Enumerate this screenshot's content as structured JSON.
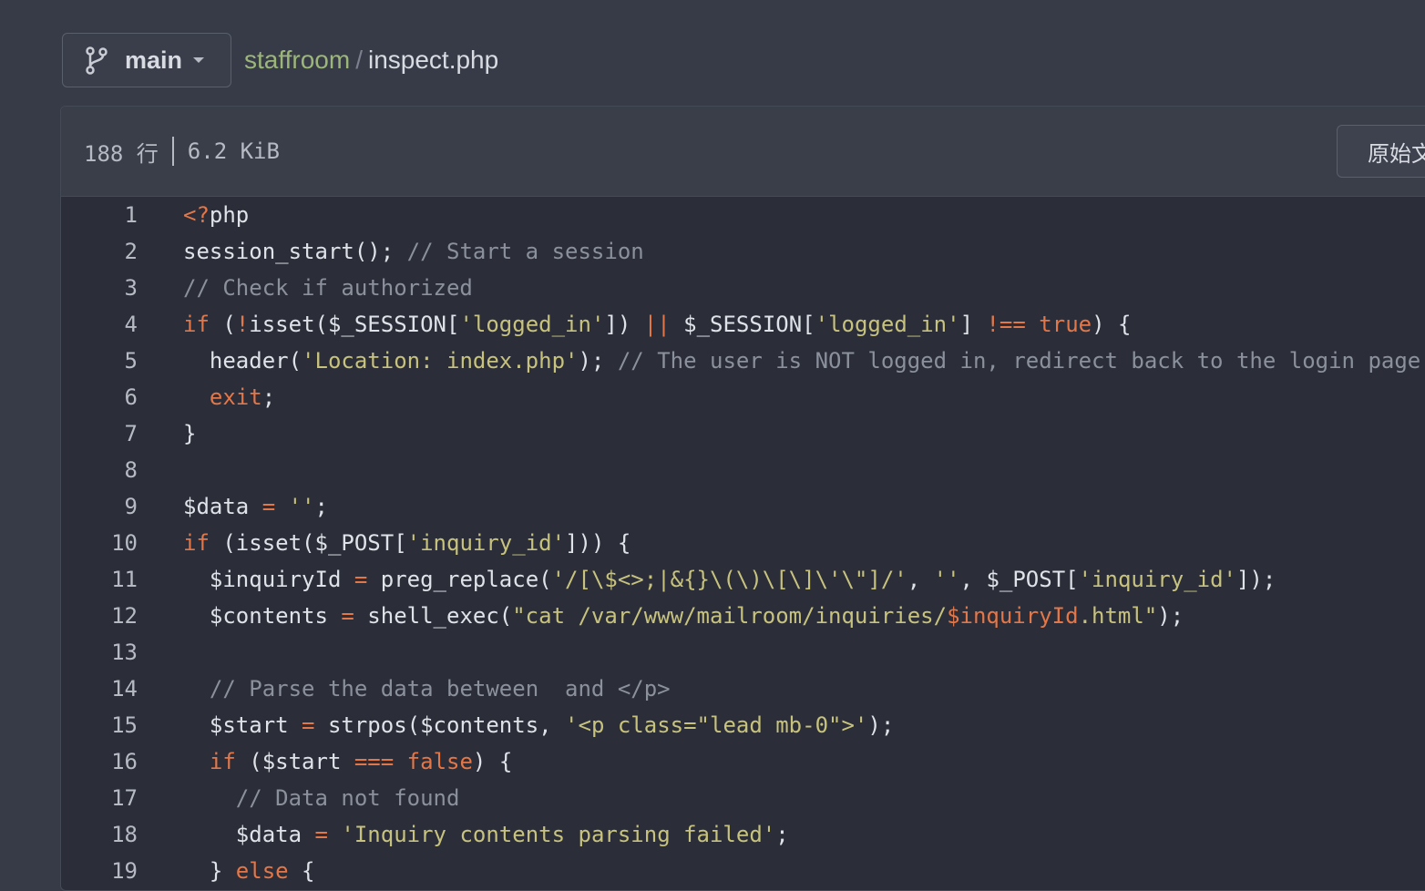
{
  "branch": {
    "label": "main",
    "icon": "git-branch-icon"
  },
  "breadcrumb": {
    "repo": "staffroom",
    "separator": "/",
    "file": "inspect.php"
  },
  "file_info": {
    "lines": "188 行",
    "size": "6.2 KiB",
    "raw_button": "原始文件"
  },
  "colors": {
    "keyword": "#e2774a",
    "string": "#c7c27e",
    "comment": "#8b909d",
    "plain": "#dfe2e8",
    "repo_link": "#9cb67a"
  },
  "code_lines": [
    {
      "n": "1",
      "tokens": [
        [
          "kw",
          "<?"
        ],
        [
          "pl",
          "php"
        ]
      ]
    },
    {
      "n": "2",
      "tokens": [
        [
          "pl",
          "session_start(); "
        ],
        [
          "cm",
          "// Start a session"
        ]
      ]
    },
    {
      "n": "3",
      "tokens": [
        [
          "cm",
          "// Check if authorized"
        ]
      ]
    },
    {
      "n": "4",
      "tokens": [
        [
          "kw",
          "if"
        ],
        [
          "pl",
          " ("
        ],
        [
          "op",
          "!"
        ],
        [
          "pl",
          "isset($_SESSION["
        ],
        [
          "str",
          "'logged_in'"
        ],
        [
          "pl",
          "]) "
        ],
        [
          "op",
          "||"
        ],
        [
          "pl",
          " $_SESSION["
        ],
        [
          "str",
          "'logged_in'"
        ],
        [
          "pl",
          "] "
        ],
        [
          "op",
          "!=="
        ],
        [
          "pl",
          " "
        ],
        [
          "kw",
          "true"
        ],
        [
          "pl",
          ") {"
        ]
      ]
    },
    {
      "n": "5",
      "tokens": [
        [
          "pl",
          "  header("
        ],
        [
          "str",
          "'Location: index.php'"
        ],
        [
          "pl",
          "); "
        ],
        [
          "cm",
          "// The user is NOT logged in, redirect back to the login page"
        ]
      ]
    },
    {
      "n": "6",
      "tokens": [
        [
          "pl",
          "  "
        ],
        [
          "kw",
          "exit"
        ],
        [
          "pl",
          ";"
        ]
      ]
    },
    {
      "n": "7",
      "tokens": [
        [
          "pl",
          "}"
        ]
      ]
    },
    {
      "n": "8",
      "tokens": []
    },
    {
      "n": "9",
      "tokens": [
        [
          "pl",
          "$data "
        ],
        [
          "op",
          "="
        ],
        [
          "pl",
          " "
        ],
        [
          "str",
          "''"
        ],
        [
          "pl",
          ";"
        ]
      ]
    },
    {
      "n": "10",
      "tokens": [
        [
          "kw",
          "if"
        ],
        [
          "pl",
          " (isset($_POST["
        ],
        [
          "str",
          "'inquiry_id'"
        ],
        [
          "pl",
          "])) {"
        ]
      ]
    },
    {
      "n": "11",
      "tokens": [
        [
          "pl",
          "  $inquiryId "
        ],
        [
          "op",
          "="
        ],
        [
          "pl",
          " preg_replace("
        ],
        [
          "str",
          "'/[\\$<>;|&{}\\(\\)\\[\\]\\'\\\"]/'"
        ],
        [
          "pl",
          ", "
        ],
        [
          "str",
          "''"
        ],
        [
          "pl",
          ", $_POST["
        ],
        [
          "str",
          "'inquiry_id'"
        ],
        [
          "pl",
          "]);"
        ]
      ]
    },
    {
      "n": "12",
      "tokens": [
        [
          "pl",
          "  $contents "
        ],
        [
          "op",
          "="
        ],
        [
          "pl",
          " shell_exec("
        ],
        [
          "str",
          "\"cat /var/www/mailroom/inquiries/"
        ],
        [
          "kw",
          "$inquiryId"
        ],
        [
          "str",
          ".html\""
        ],
        [
          "pl",
          ");"
        ]
      ]
    },
    {
      "n": "13",
      "tokens": []
    },
    {
      "n": "14",
      "tokens": [
        [
          "pl",
          "  "
        ],
        [
          "cm",
          "// Parse the data between  and </p>"
        ]
      ]
    },
    {
      "n": "15",
      "tokens": [
        [
          "pl",
          "  $start "
        ],
        [
          "op",
          "="
        ],
        [
          "pl",
          " strpos($contents, "
        ],
        [
          "str",
          "'<p class=\"lead mb-0\">'"
        ],
        [
          "pl",
          ");"
        ]
      ]
    },
    {
      "n": "16",
      "tokens": [
        [
          "pl",
          "  "
        ],
        [
          "kw",
          "if"
        ],
        [
          "pl",
          " ($start "
        ],
        [
          "op",
          "==="
        ],
        [
          "pl",
          " "
        ],
        [
          "kw",
          "false"
        ],
        [
          "pl",
          ") {"
        ]
      ]
    },
    {
      "n": "17",
      "tokens": [
        [
          "pl",
          "    "
        ],
        [
          "cm",
          "// Data not found"
        ]
      ]
    },
    {
      "n": "18",
      "tokens": [
        [
          "pl",
          "    $data "
        ],
        [
          "op",
          "="
        ],
        [
          "pl",
          " "
        ],
        [
          "str",
          "'Inquiry contents parsing failed'"
        ],
        [
          "pl",
          ";"
        ]
      ]
    },
    {
      "n": "19",
      "tokens": [
        [
          "pl",
          "  } "
        ],
        [
          "kw",
          "else"
        ],
        [
          "pl",
          " {"
        ]
      ]
    }
  ]
}
